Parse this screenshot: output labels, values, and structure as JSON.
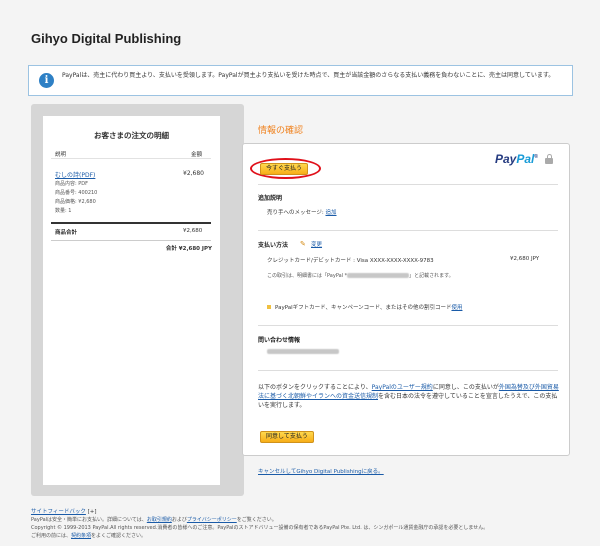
{
  "merchant": {
    "name": "Gihyo Digital Publishing"
  },
  "banner": {
    "icon": "info-icon",
    "text": "PayPalは、売主に代わり買主より、支払いを受領します。PayPalが買主より支払いを受けた時点で、買主が当該金額のさらなる支払い義務を負わないことに、売主は同意しています。"
  },
  "order": {
    "title": "お客さまの注文の明細",
    "col_description": "説明",
    "col_amount": "金額",
    "item": {
      "name": "むしの詩(PDF)",
      "price": "¥2,680",
      "details": [
        "商品内容: PDF",
        "商品番号: 400210",
        "商品価格: ¥2,680",
        "数量: 1"
      ]
    },
    "subtotal_label": "商品合計",
    "subtotal_value": "¥2,680",
    "total": "合計 ¥2,680 JPY"
  },
  "review": {
    "title": "情報の確認",
    "pay_now_label": "今すぐ支払う",
    "logo": {
      "pay": "Pay",
      "pal": "Pal",
      "mark": "®"
    },
    "additional": {
      "heading": "追加説明",
      "label": "売り手へのメッセージ:",
      "link": "追加"
    },
    "payment": {
      "heading": "支払い方法",
      "change_link": "変更",
      "card": "クレジットカード/デビットカード : Visa XXXX-XXXX-XXXX-9783",
      "amount": "¥2,680 JPY",
      "statement_before": "この取引は、明細書には「PayPal *",
      "statement_after": "」と記載されます。",
      "gift_text": "PayPalギフトカード、キャンペーンコード、またはその他の割引コード",
      "gift_link": "使用"
    },
    "contact": {
      "heading": "問い合わせ情報"
    },
    "terms": {
      "t1": "以下のボタンをクリックすることにより、",
      "l1": "PayPalのユーザー規約",
      "t2": "に同意し、この支払いが",
      "l2": "外国為替及び外国貿易法に基づく北朝鮮やイランへの資金送信規制",
      "t3": "を含む日本の法令を遵守していることを宣言したうえで、この支払いを実行します。"
    },
    "agree_pay_label": "同意して支払う",
    "cancel_link": "キャンセルしてGihyo Digital Publishingに戻る。"
  },
  "footer": {
    "feedback": "サイトフィードバック",
    "feedback_mark": "[+]",
    "line1_text": "PayPalは安全・簡単にお支払い。詳細については、",
    "line1_link1": "お取引規約",
    "line1_mid": "および",
    "line1_link2": "プライバシーポリシー",
    "line1_end": "をご覧ください。",
    "copyright": "Copyright © 1999-2013 PayPal.All rights reserved.消費者の皆様へのご注意。PayPalのストアドバリュー設備の保有者であるPayPal Pte. Ltd. は、シンガポール通貨金融庁の承認を必要としません。",
    "line3_text": "ご利用の前には、",
    "line3_link": "契約条項",
    "line3_end": "をよくご確認ください。"
  },
  "colors": {
    "accent": "#f0821e",
    "link": "#1a5ba8",
    "highlight": "#e0101a",
    "button": "#f7ae18"
  }
}
